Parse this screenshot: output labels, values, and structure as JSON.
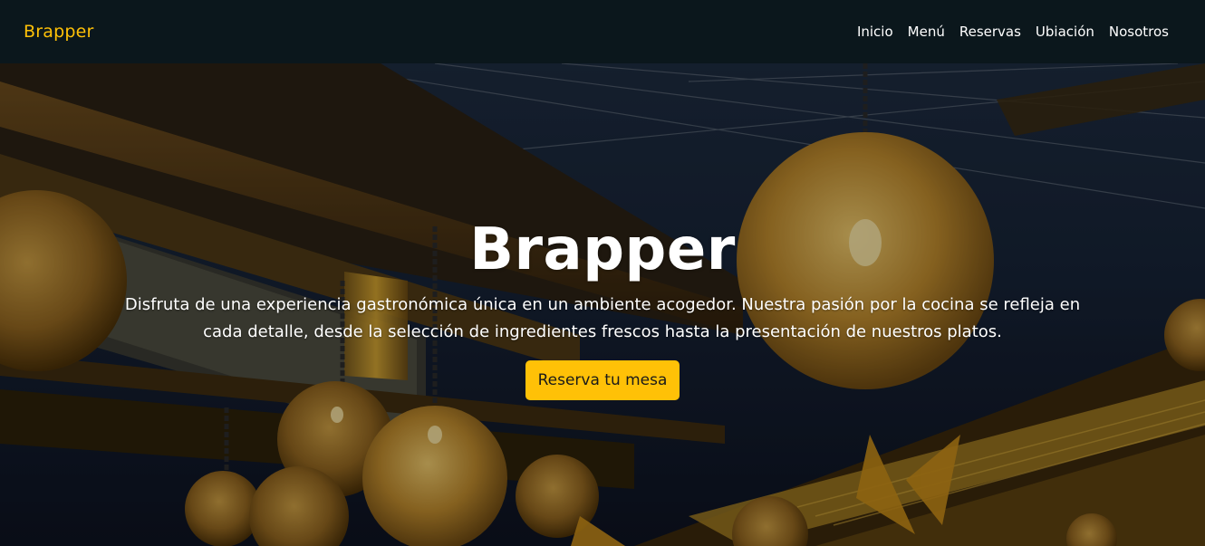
{
  "brand": {
    "name": "Brapper",
    "color": "#ffc107"
  },
  "nav": {
    "items": [
      {
        "label": "Inicio"
      },
      {
        "label": "Menú"
      },
      {
        "label": "Reservas"
      },
      {
        "label": "Ubiación"
      },
      {
        "label": "Nosotros"
      }
    ]
  },
  "hero": {
    "title": "Brapper",
    "text": "Disfruta de una experiencia gastronómica única en un ambiente acogedor. Nuestra pasión por la cocina se refleja en cada detalle, desde la selección de ingredientes frescos hasta la presentación de nuestros platos.",
    "cta_label": "Reserva tu mesa",
    "background_image": "night-restaurant-terrace-with-hanging-lanterns"
  },
  "colors": {
    "navbar_bg": "#0b171c",
    "accent": "#ffc107",
    "text": "#ffffff"
  }
}
